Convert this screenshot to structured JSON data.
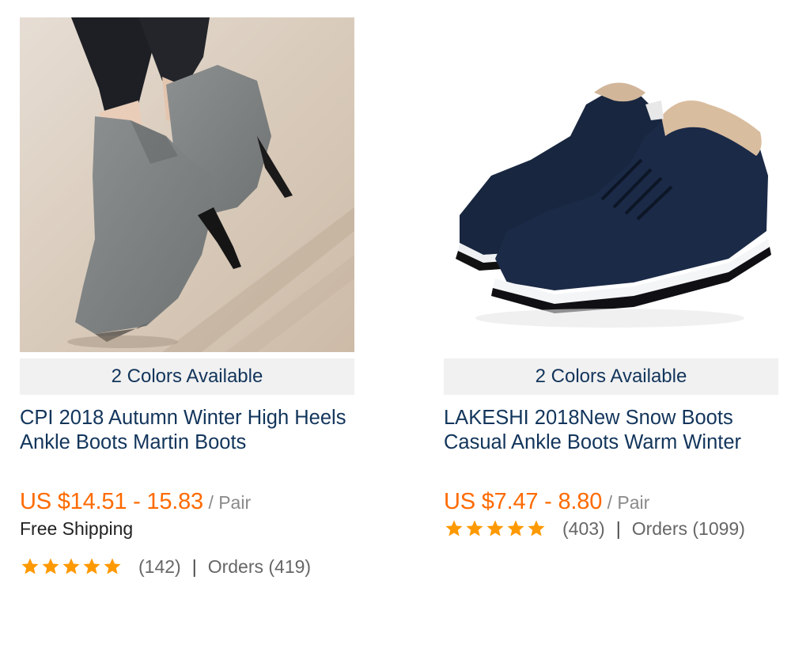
{
  "products": [
    {
      "image_icon": "gray-high-heel-ankle-boot-image",
      "colors": "2 Colors Available",
      "title": "CPI 2018 Autumn Winter High Heels Ankle Boots Martin Boots",
      "price": "US $14.51 - 15.83",
      "unit": "/ Pair",
      "shipping": "Free Shipping",
      "rating": 5,
      "reviews": "(142)",
      "separator": "|",
      "orders": "Orders (419)"
    },
    {
      "image_icon": "navy-fur-lined-sneaker-boot-image",
      "colors": "2 Colors Available",
      "title": "LAKESHI 2018New Snow Boots Casual Ankle Boots Warm Winter",
      "price": "US $7.47 - 8.80",
      "unit": "/ Pair",
      "rating": 5,
      "reviews": "(403)",
      "separator": "|",
      "orders": "Orders (1099)"
    }
  ],
  "colors": {
    "link": "#12355b",
    "price": "#ff6a00",
    "star": "#ff9900",
    "colors_bar_bg": "#f1f1f1"
  }
}
